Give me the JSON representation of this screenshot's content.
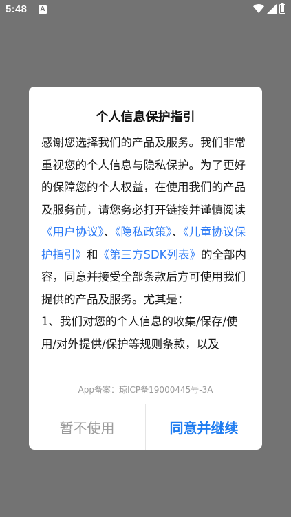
{
  "status_bar": {
    "time": "5:48",
    "notification_badge": "A",
    "icons": [
      "wifi-icon",
      "signal-icon",
      "battery-icon"
    ]
  },
  "dialog": {
    "title": "个人信息保护指引",
    "body": {
      "intro": "感谢您选择我们的产品及服务。我们非常重视您的个人信息与隐私保护。为了更好的保障您的个人权益，在使用我们的产品及服务前，请您务必打开链接并谨慎阅读",
      "link_user_agreement": "《用户协议》",
      "sep1": "、",
      "link_privacy_policy": "《隐私政策》",
      "sep2": "、",
      "link_child_protection": "《儿童协议保护指引》",
      "sep3": "和",
      "link_sdk_list": "《第三方SDK列表》",
      "after_links": "的全部内容，同意并接受全部条款后方可使用我们提供的产品及服务。尤其是：",
      "point1": "1、我们对您的个人信息的收集/保存/使用/对外提供/保护等规则条款，以及"
    },
    "filing": "App备案：琼ICP备19000445号-3A",
    "decline_label": "暂不使用",
    "accept_label": "同意并继续"
  },
  "colors": {
    "backdrop": "#737373",
    "link": "#2f7cf6",
    "accept": "#1f7cf0",
    "decline": "#9a9a9a"
  }
}
